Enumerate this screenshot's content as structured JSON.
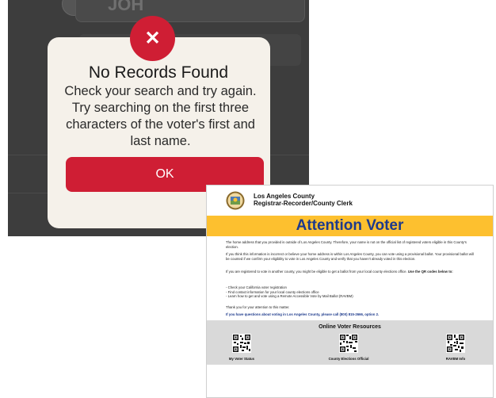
{
  "phone": {
    "background_field_text": "JOH",
    "dialog": {
      "icon": "close-x-icon",
      "icon_glyph": "✕",
      "title": "No Records Found",
      "message": "Check your search and try again. Try searching on the first three characters of the voter's first and last name.",
      "ok_label": "OK"
    },
    "colors": {
      "accent": "#cf1e34",
      "dialog_bg": "#f5f1ea",
      "screen_bg": "#3d3d3d"
    }
  },
  "notice": {
    "org_name": "Los Angeles County",
    "org_dept": "Registrar-Recorder/County Clerk",
    "headline": "Attention Voter",
    "para1": "The home address that you provided is outside of Los Angeles County. Therefore, your name is not on the official list of registered voters eligible in this County's election.",
    "para2": "If you think this information is incorrect or believe your home address is within Los Angeles County, you can vote using a provisional ballot. Your provisional ballot will be counted if we confirm your eligibility to vote in Los Angeles County and verify that you haven't already voted in this election.",
    "para3_lead": "If you are registered to vote in another county, you might be eligible to get a ballot from your local county elections office.",
    "para3_bold": "Use the QR codes below to:",
    "list": [
      "- Check your California voter registration",
      "- Find contact information for your local county elections office",
      "- Learn how to get and vote using a Remote Accessible Vote by Mail Ballot (RAVBM)"
    ],
    "thanks": "Thank you for your attention to this matter.",
    "question": "If you have questions about voting in Los Angeles County, please call (800) 815-2666, option 2.",
    "resources_title": "Online Voter Resources",
    "qr_labels": [
      "My Voter Status",
      "County Elections Official",
      "RAVBM Info"
    ],
    "colors": {
      "headline": "#1d3a8c",
      "banner": "#fdc02f",
      "resources_bg": "#d9d9d9"
    }
  }
}
